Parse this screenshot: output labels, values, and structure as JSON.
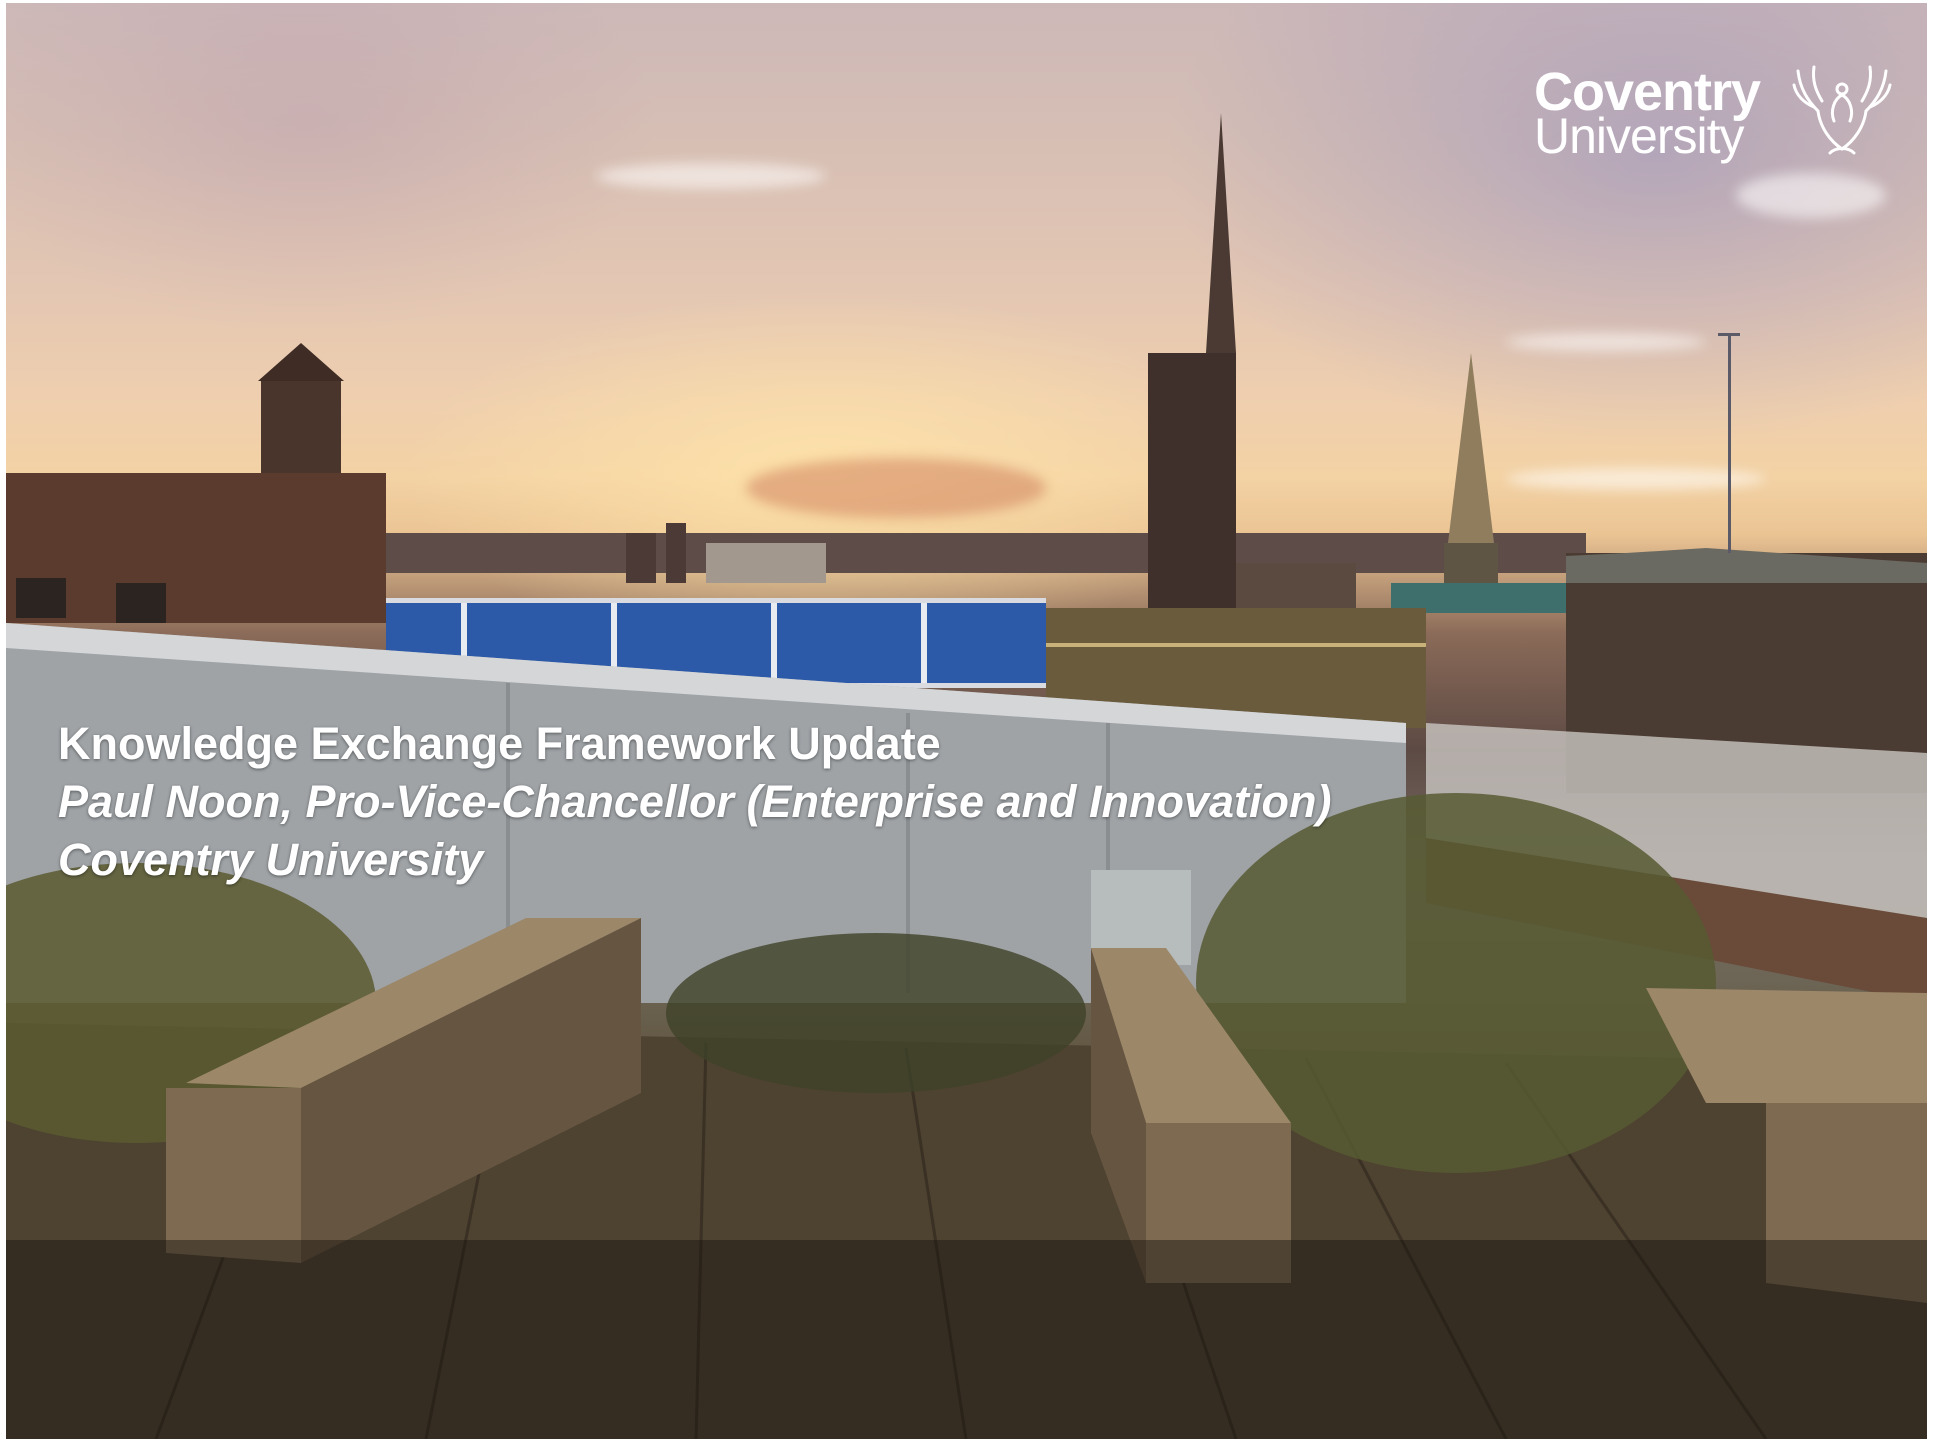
{
  "logo": {
    "line1": "Coventry",
    "line2": "University",
    "emblem_icon": "phoenix-emblem-icon"
  },
  "title": {
    "main": "Knowledge Exchange Framework Update",
    "presenter": "Paul Noon, Pro-Vice-Chancellor (Enterprise and Innovation)",
    "organisation": "Coventry University"
  },
  "colors": {
    "text": "#ffffff",
    "sky_warm": "#efcfae",
    "deck_wood": "#4f4431"
  }
}
